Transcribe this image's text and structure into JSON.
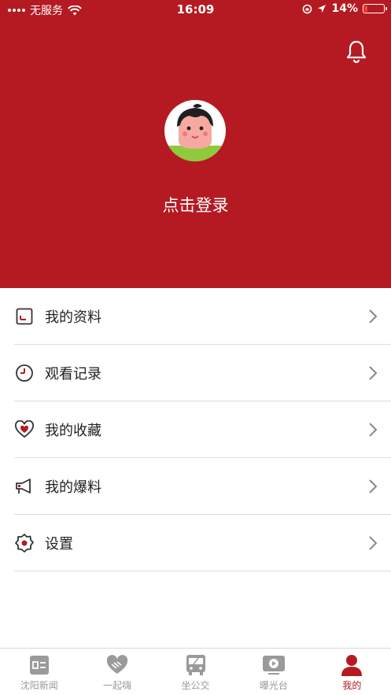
{
  "status_bar": {
    "carrier": "无服务",
    "time": "16:09",
    "battery": "14%"
  },
  "header": {
    "login_label": "点击登录"
  },
  "menu": {
    "items": [
      {
        "label": "我的资料",
        "icon": "profile-icon"
      },
      {
        "label": "观看记录",
        "icon": "clock-icon"
      },
      {
        "label": "我的收藏",
        "icon": "heart-icon"
      },
      {
        "label": "我的爆料",
        "icon": "megaphone-icon"
      },
      {
        "label": "设置",
        "icon": "gear-icon"
      }
    ]
  },
  "tabbar": {
    "tabs": [
      {
        "label": "沈阳新闻",
        "icon": "news-icon",
        "active": false
      },
      {
        "label": "一起嗨",
        "icon": "hands-heart-icon",
        "active": false
      },
      {
        "label": "坐公交",
        "icon": "bus-icon",
        "active": false
      },
      {
        "label": "曝光台",
        "icon": "video-icon",
        "active": false
      },
      {
        "label": "我的",
        "icon": "person-icon",
        "active": true
      }
    ]
  },
  "colors": {
    "brand_red": "#b51a22",
    "inactive_gray": "#9a9a9a"
  }
}
